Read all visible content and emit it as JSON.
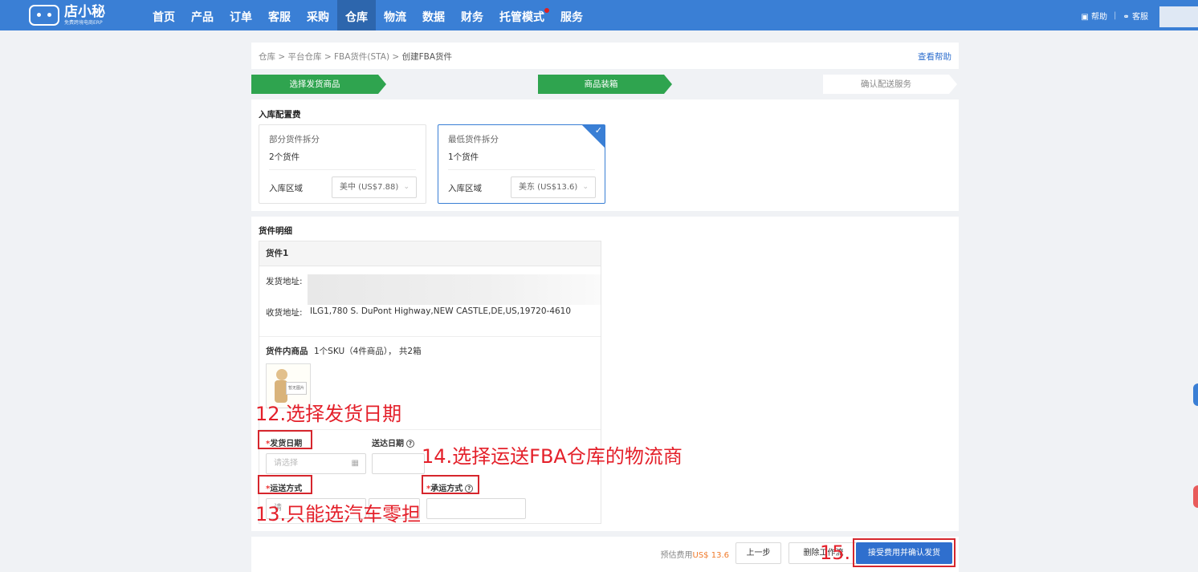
{
  "app": {
    "logo_name": "店小秘",
    "logo_sub": "免费跨境电商ERP"
  },
  "nav": {
    "items": [
      "首页",
      "产品",
      "订单",
      "客服",
      "采购",
      "仓库",
      "物流",
      "数据",
      "财务",
      "托管模式",
      "服务"
    ],
    "active": "仓库",
    "help": "帮助",
    "service": "客服"
  },
  "breadcrumb": {
    "items": [
      "仓库",
      "平台仓库",
      "FBA货件(STA)",
      "创建FBA货件"
    ],
    "separator": ">",
    "help_link": "查看帮助"
  },
  "steps": [
    "选择发货商品",
    "商品装箱",
    "确认配送服务"
  ],
  "fee": {
    "title": "入库配置费",
    "options": [
      {
        "title": "部分货件拆分",
        "count": "2个货件",
        "region_label": "入库区域",
        "region_value": "美中 (US$7.88)",
        "selected": false
      },
      {
        "title": "最低货件拆分",
        "count": "1个货件",
        "region_label": "入库区域",
        "region_value": "美东 (US$13.6)",
        "selected": true
      }
    ]
  },
  "detail": {
    "title": "货件明细",
    "shipment_title": "货件1",
    "ship_from_label": "发货地址:",
    "ship_to_label": "收货地址:",
    "ship_to_value": "ILG1,780 S. DuPont Highway,NEW CASTLE,DE,US,19720-4610",
    "items_label": "货件内商品",
    "items_summary": "1个SKU（4件商品），  共2箱",
    "no_image": "暂无图片",
    "ship_date_label": "发货日期",
    "ship_date_placeholder": "请选择",
    "arrival_label": "送达日期",
    "transport_label": "运送方式",
    "transport_value": "请",
    "carrier_label": "承运方式"
  },
  "footer": {
    "est_label": "预估费用",
    "est_amount": "US$ 13.6",
    "prev_button": "上一步",
    "delete_button": "删除工作流",
    "confirm_button": "接受费用并确认发货"
  },
  "annotations": {
    "a12": "12.选择发货日期",
    "a13": "13.只能选汽车零担",
    "a14": "14.选择运送FBA仓库的物流商",
    "a15": "15."
  },
  "colors": {
    "topbar": "#3a7fd5",
    "step_done": "#2fa44f",
    "primary": "#2f6fce",
    "annotation": "#e4202a"
  }
}
